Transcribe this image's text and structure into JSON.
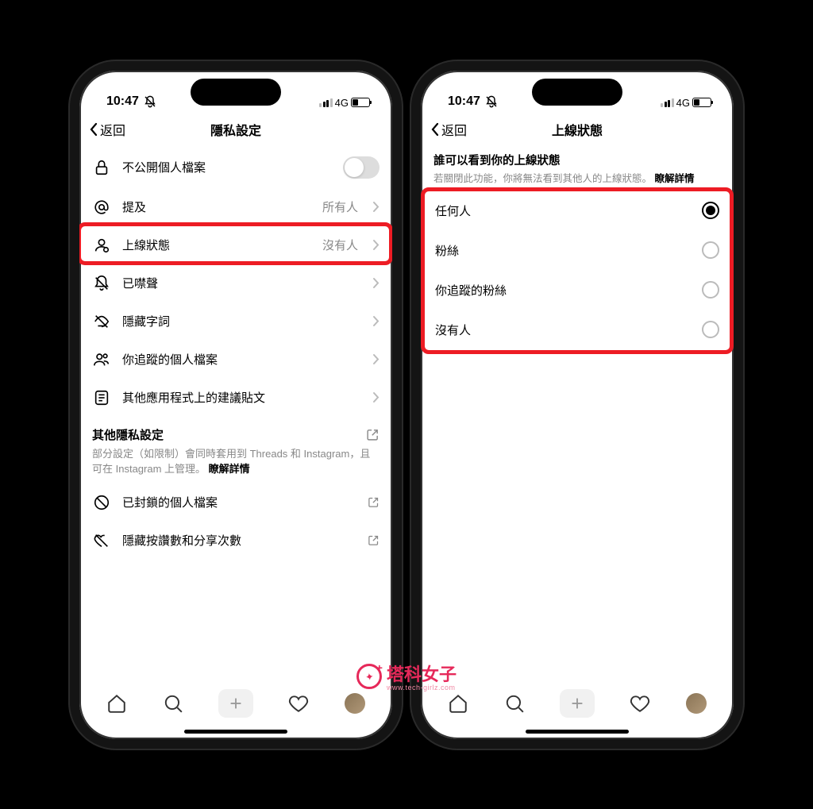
{
  "statusBar": {
    "time": "10:47",
    "network": "4G"
  },
  "left": {
    "back": "返回",
    "title": "隱私設定",
    "rows": {
      "privateProfile": "不公開個人檔案",
      "mentions": {
        "label": "提及",
        "value": "所有人"
      },
      "onlineStatus": {
        "label": "上線狀態",
        "value": "沒有人"
      },
      "muted": "已噤聲",
      "hiddenWords": "隱藏字詞",
      "profilesYouFollow": "你追蹤的個人檔案",
      "suggestedPosts": "其他應用程式上的建議貼文"
    },
    "otherSection": {
      "title": "其他隱私設定",
      "desc": "部分設定（如限制）會同時套用到 Threads 和 Instagram，且可在 Instagram 上管理。",
      "learnMore": "瞭解詳情",
      "blocked": "已封鎖的個人檔案",
      "hideLikes": "隱藏按讚數和分享次數"
    }
  },
  "right": {
    "back": "返回",
    "title": "上線狀態",
    "sectionTitle": "誰可以看到你的上線狀態",
    "sectionDesc": "若關閉此功能，你將無法看到其他人的上線狀態。",
    "learnMore": "瞭解詳情",
    "options": {
      "everyone": "任何人",
      "followers": "粉絲",
      "followersYouFollow": "你追蹤的粉絲",
      "nobody": "沒有人"
    }
  },
  "watermark": {
    "title": "塔科女子",
    "sub": "www.tech-girlz.com"
  }
}
